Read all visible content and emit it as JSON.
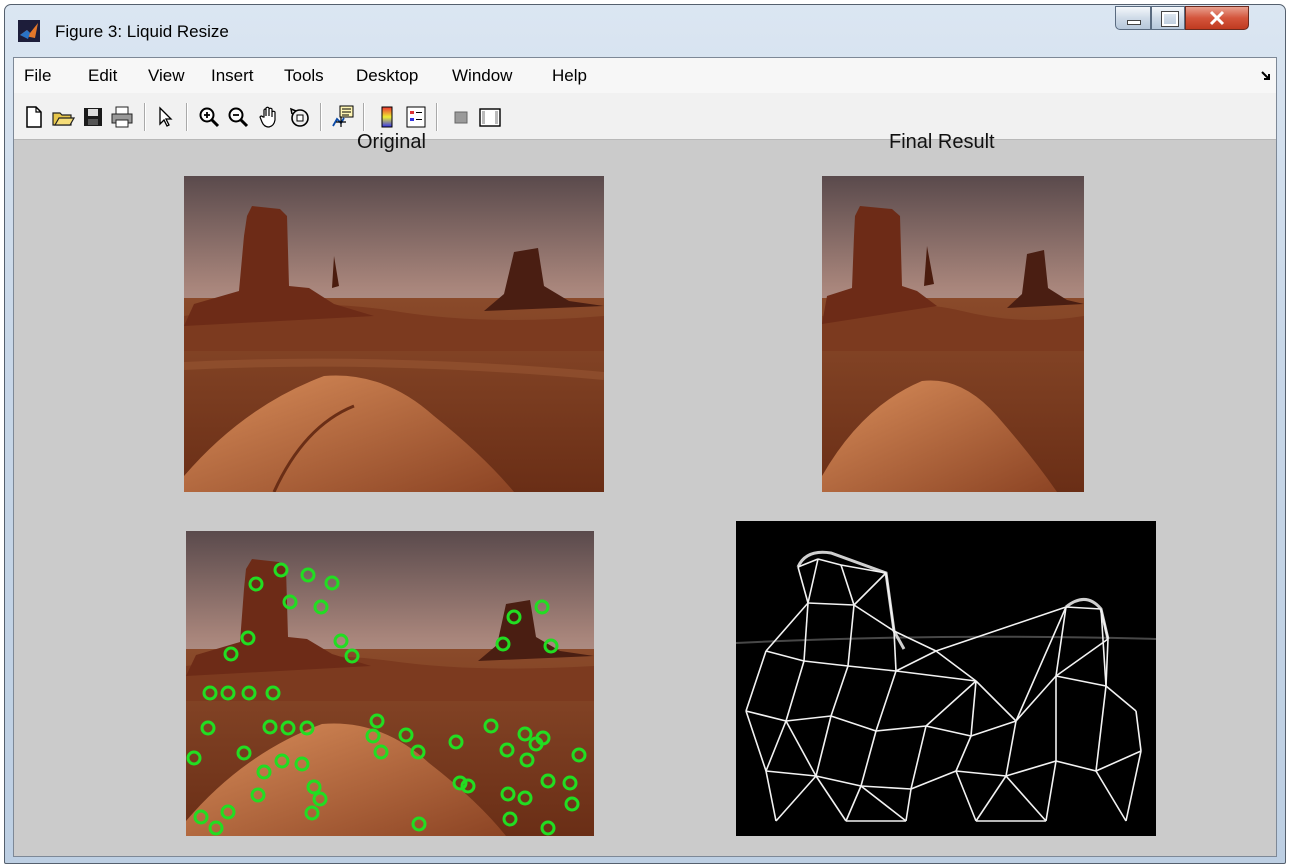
{
  "window": {
    "title": "Figure 3: Liquid Resize",
    "controls": {
      "minimize": "minimize-icon",
      "maximize": "maximize-icon",
      "close": "close-icon"
    }
  },
  "menu": [
    "File",
    "Edit",
    "View",
    "Insert",
    "Tools",
    "Desktop",
    "Window",
    "Help"
  ],
  "toolbar": {
    "icons": [
      "new-figure-icon",
      "open-file-icon",
      "save-icon",
      "print-icon",
      "edit-plot-arrow-icon",
      "zoom-in-icon",
      "zoom-out-icon",
      "pan-hand-icon",
      "rotate-3d-icon",
      "data-cursor-icon",
      "insert-colorbar-icon",
      "insert-legend-icon",
      "hide-plot-tools-icon",
      "show-plot-tools-icon"
    ]
  },
  "axes": {
    "top_left_title": "Original",
    "top_right_title": "Final Result"
  },
  "colors": {
    "feature_markers": "#22dd22",
    "figure_background": "#cbcbcb",
    "mesh_lines": "#f2f2f2"
  }
}
